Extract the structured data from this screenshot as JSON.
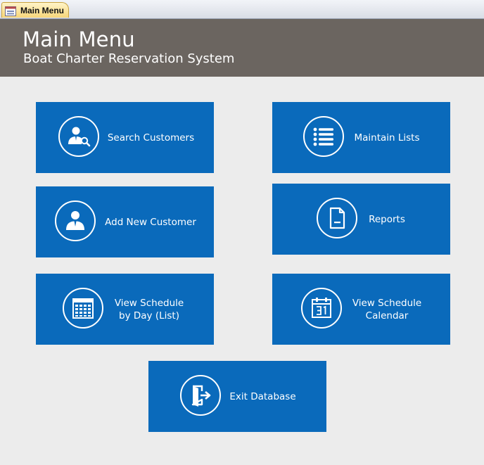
{
  "tab": {
    "label": "Main Menu"
  },
  "header": {
    "title": "Main Menu",
    "subtitle": "Boat Charter Reservation System"
  },
  "buttons": {
    "search_customers": "Search Customers",
    "maintain_lists": "Maintain Lists",
    "add_new_customer": "Add New Customer",
    "reports": "Reports",
    "view_schedule_day": "View Schedule\nby Day (List)",
    "view_schedule_calendar": "View Schedule\nCalendar",
    "exit_database": "Exit Database"
  },
  "icons": {
    "search_customers": "person-search-icon",
    "maintain_lists": "list-icon",
    "add_new_customer": "person-icon",
    "reports": "document-icon",
    "view_schedule_day": "calendar-grid-icon",
    "view_schedule_calendar": "calendar-31-icon",
    "exit_database": "exit-door-icon"
  },
  "colors": {
    "button": "#0a6abb",
    "header": "#6b6560",
    "background": "#ececec",
    "tab": "#f7d67a"
  }
}
